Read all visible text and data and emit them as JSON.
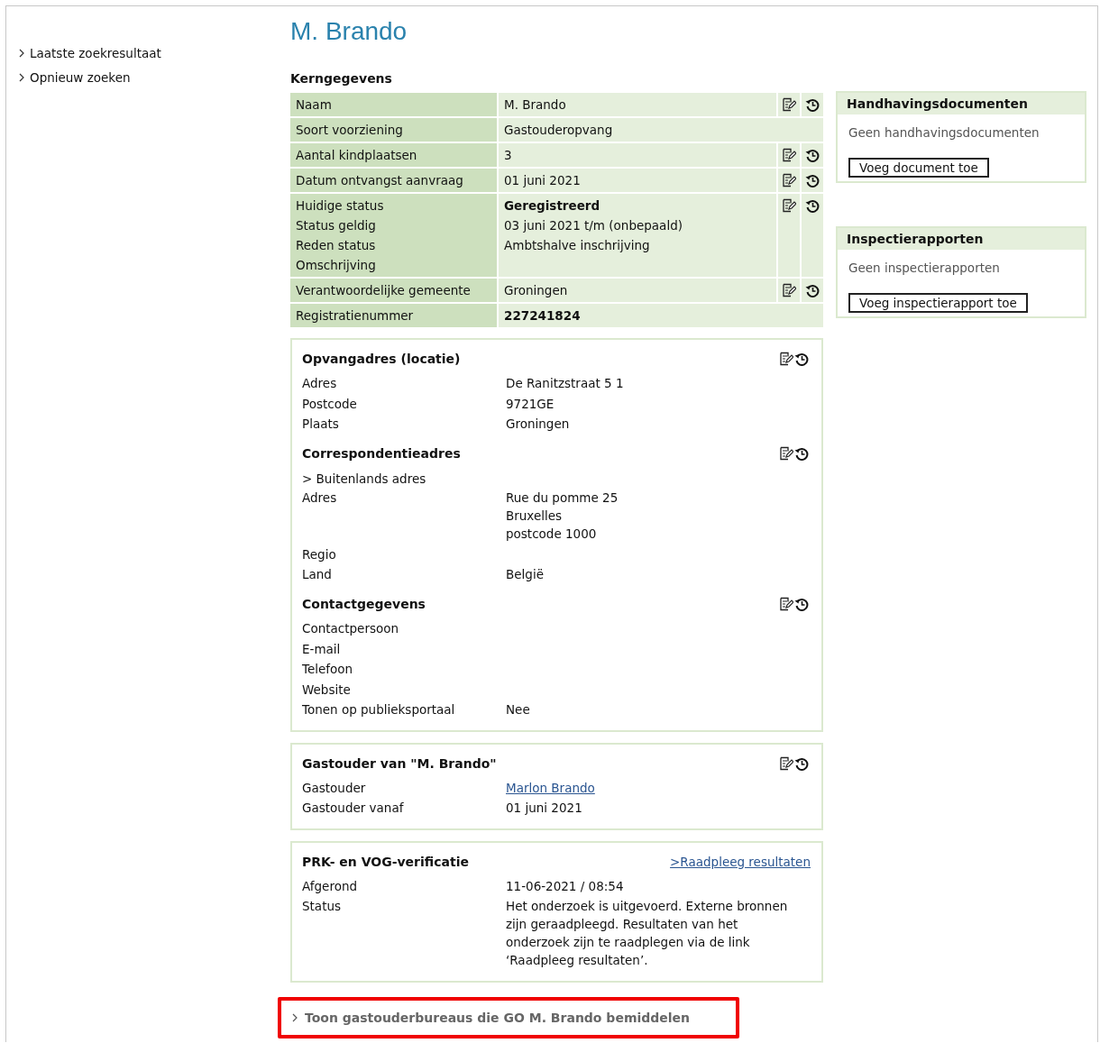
{
  "sidebar": {
    "links": [
      "Laatste zoekresultaat",
      "Opnieuw zoeken"
    ]
  },
  "title": "M. Brando",
  "core": {
    "heading": "Kerngegevens",
    "rows": [
      {
        "editable": true,
        "lines": [
          {
            "label": "Naam",
            "value": "M. Brando",
            "bold": false
          }
        ]
      },
      {
        "editable": false,
        "lines": [
          {
            "label": "Soort voorziening",
            "value": "Gastouderopvang",
            "bold": false
          }
        ]
      },
      {
        "editable": true,
        "lines": [
          {
            "label": "Aantal kindplaatsen",
            "value": "3",
            "bold": false
          }
        ]
      },
      {
        "editable": true,
        "lines": [
          {
            "label": "Datum ontvangst aanvraag",
            "value": "01 juni 2021",
            "bold": false
          }
        ]
      },
      {
        "editable": true,
        "lines": [
          {
            "label": "Huidige status",
            "value": "Geregistreerd",
            "bold": true
          },
          {
            "label": "Status geldig",
            "value": "03 juni 2021 t/m (onbepaald)",
            "bold": false
          },
          {
            "label": "Reden status",
            "value": "Ambtshalve inschrijving",
            "bold": false
          },
          {
            "label": "Omschrijving"
          }
        ]
      },
      {
        "editable": true,
        "lines": [
          {
            "label": "Verantwoordelijke gemeente",
            "value": "Groningen",
            "bold": false
          }
        ]
      },
      {
        "editable": false,
        "lines": [
          {
            "label": "Registratienummer",
            "value": "227241824",
            "bold": true
          }
        ]
      }
    ]
  },
  "panels": [
    {
      "groups": [
        {
          "title": "Opvangadres (locatie)",
          "editable": true,
          "items": [
            {
              "kind": "field",
              "label": "Adres",
              "lines": [
                "De Ranitzstraat 5 1"
              ]
            },
            {
              "kind": "field",
              "label": "Postcode",
              "lines": [
                "9721GE"
              ]
            },
            {
              "kind": "field",
              "label": "Plaats",
              "lines": [
                "Groningen"
              ]
            }
          ]
        },
        {
          "title": "Correspondentieadres",
          "editable": true,
          "items": [
            {
              "kind": "note",
              "label": "> Buitenlands adres"
            },
            {
              "kind": "field",
              "label": "Adres",
              "lines": [
                "Rue du pomme 25",
                "Bruxelles",
                "postcode 1000"
              ]
            },
            {
              "kind": "field",
              "label": "Regio"
            },
            {
              "kind": "field",
              "label": "Land",
              "lines": [
                "België"
              ]
            }
          ]
        },
        {
          "title": "Contactgegevens",
          "editable": true,
          "items": [
            {
              "kind": "field",
              "label": "Contactpersoon"
            },
            {
              "kind": "field",
              "label": "E-mail"
            },
            {
              "kind": "field",
              "label": "Telefoon"
            },
            {
              "kind": "field",
              "label": "Website"
            },
            {
              "kind": "field",
              "label": "Tonen op publieksportaal",
              "lines": [
                "Nee"
              ]
            }
          ]
        }
      ]
    },
    {
      "groups": [
        {
          "title": "Gastouder van \"M. Brando\"",
          "editable": true,
          "items": [
            {
              "kind": "link",
              "label": "Gastouder",
              "lines": [
                "Marlon Brando"
              ]
            },
            {
              "kind": "field",
              "label": "Gastouder vanaf",
              "lines": [
                "01 juni 2021"
              ]
            }
          ]
        }
      ]
    },
    {
      "groups": [
        {
          "title": "PRK- en VOG-verificatie",
          "editable": false,
          "link": ">Raadpleeg resultaten",
          "items": [
            {
              "kind": "field",
              "label": "Afgerond",
              "lines": [
                "11-06-2021 / 08:54"
              ]
            },
            {
              "kind": "field",
              "label": "Status",
              "lines": [
                "Het onderzoek is uitgevoerd. Externe bronnen zijn geraadpleegd. Resultaten van het onderzoek zijn te raadplegen via de link ‘Raadpleeg resultaten’."
              ]
            }
          ]
        }
      ]
    }
  ],
  "bottom_link": {
    "text": "Toon gastouderbureaus die GO M. Brando bemiddelen",
    "highlighted": true
  },
  "side_boxes": [
    {
      "title": "Handhavingsdocumenten",
      "empty_text": "Geen handhavingsdocumenten",
      "button": "Voeg document toe"
    },
    {
      "title": "Inspectierapporten",
      "empty_text": "Geen inspectierapporten",
      "button": "Voeg inspectierapport toe"
    }
  ]
}
